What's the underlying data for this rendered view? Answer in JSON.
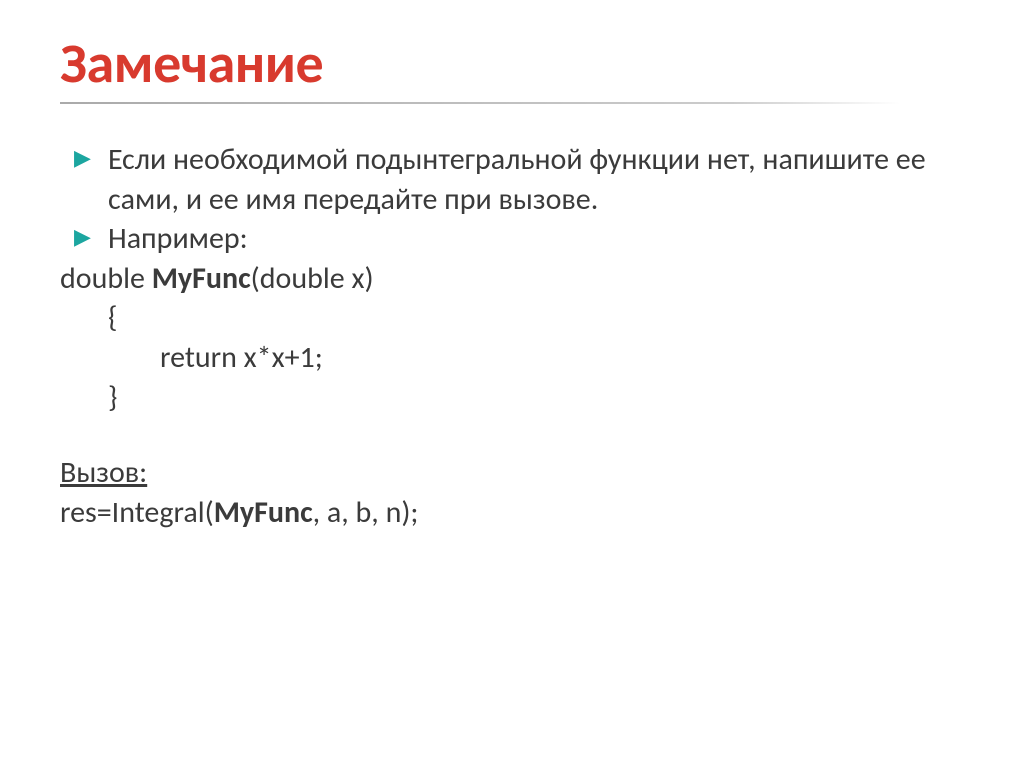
{
  "title": "Замечание",
  "bullet1_text": "Если необходимой подынтегральной функции нет, напишите ее сами, и ее имя передайте при вызове.",
  "bullet2_text": "Например:",
  "code": {
    "line1_pre": "double ",
    "line1_bold": "MyFunc",
    "line1_post": "(double x)",
    "line2": "{",
    "line3": "return x*x+1;",
    "line4": "}"
  },
  "call_label": "Вызов:",
  "call_line_pre": "res=Integral(",
  "call_line_bold": "MyFunc",
  "call_line_post": ", a, b, n);"
}
